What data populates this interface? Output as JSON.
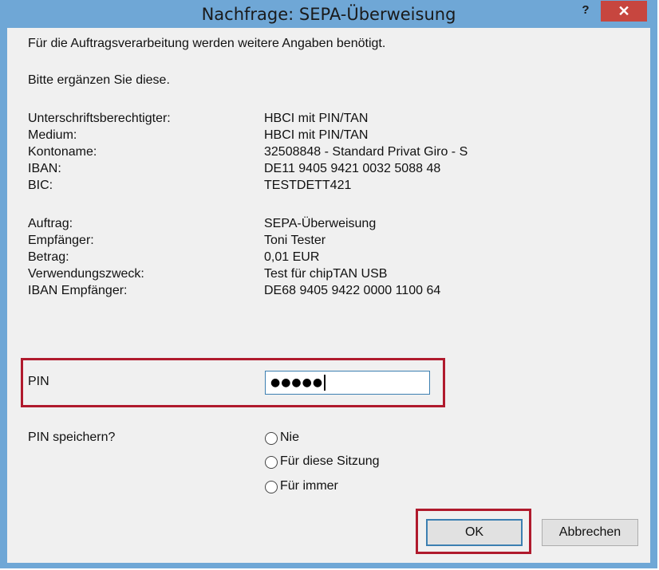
{
  "window": {
    "title": "Nachfrage: SEPA-Überweisung",
    "help_glyph": "?",
    "close_glyph": "✕",
    "colors": {
      "titlebar": "#6fa7d6",
      "close": "#c7463f",
      "highlight": "#b01a2d",
      "focus": "#3c7fb1"
    }
  },
  "intro": {
    "line1": "Für die Auftragsverarbeitung werden weitere Angaben benötigt.",
    "line2": "Bitte ergänzen Sie diese."
  },
  "account": [
    {
      "label": "Unterschriftsberechtigter:",
      "value": "HBCI mit PIN/TAN"
    },
    {
      "label": "Medium:",
      "value": "HBCI mit PIN/TAN"
    },
    {
      "label": "Kontoname:",
      "value": "32508848 - Standard Privat Giro - S"
    },
    {
      "label": "IBAN:",
      "value": "DE11 9405 9421 0032 5088 48"
    },
    {
      "label": "BIC:",
      "value": "TESTDETT421"
    }
  ],
  "order": [
    {
      "label": "Auftrag:",
      "value": "SEPA-Überweisung"
    },
    {
      "label": "Empfänger:",
      "value": "Toni Tester"
    },
    {
      "label": "Betrag:",
      "value": "0,01 EUR"
    },
    {
      "label": "Verwendungszweck:",
      "value": "Test für chipTAN USB"
    },
    {
      "label": "IBAN Empfänger:",
      "value": "DE68 9405 9422 0000 1100 64"
    }
  ],
  "pin": {
    "label": "PIN",
    "masked_value": "●●●●●"
  },
  "save_pin": {
    "label": "PIN speichern?",
    "options": [
      "Nie",
      "Für diese Sitzung",
      "Für immer"
    ]
  },
  "buttons": {
    "ok": "OK",
    "cancel": "Abbrechen"
  }
}
